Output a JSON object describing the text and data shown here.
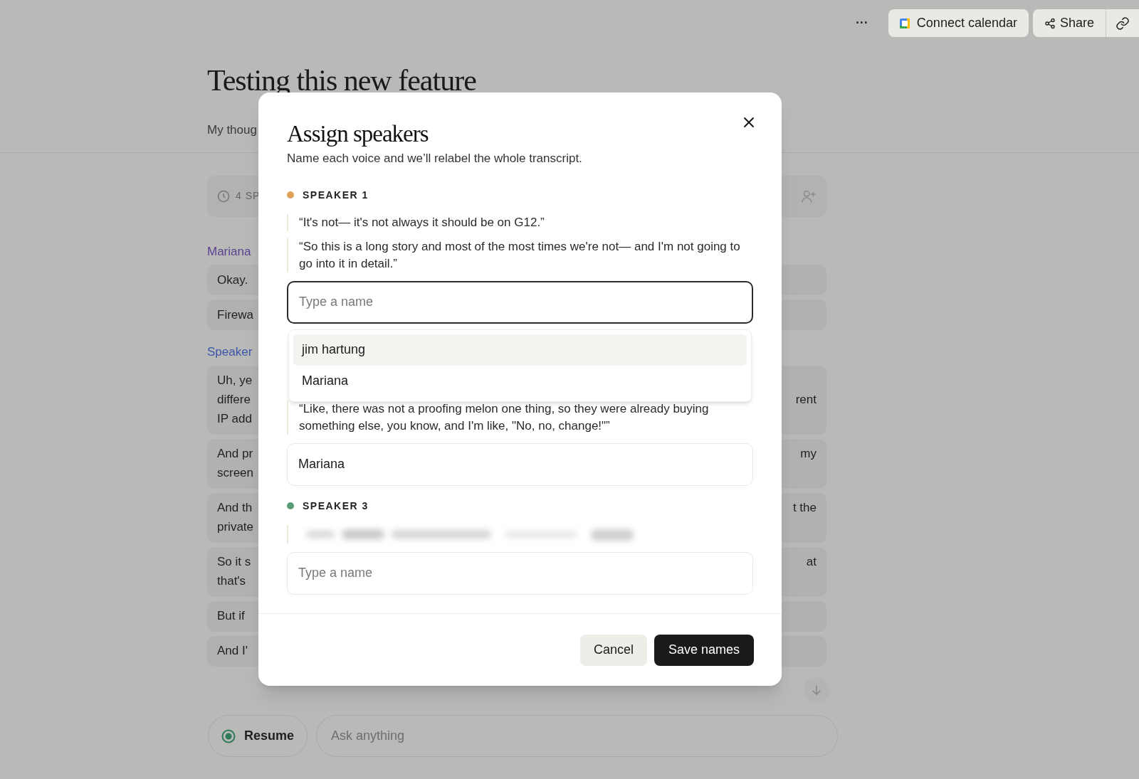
{
  "top_bar": {
    "more": "···",
    "connect_calendar": "Connect calendar",
    "share": "Share"
  },
  "document": {
    "title": "Testing this new feature",
    "subtitle": "My thoug",
    "toolbar_label": "4 SP"
  },
  "transcript": [
    {
      "speaker": "Mariana",
      "color": "#5b3f93",
      "messages": [
        {
          "lines": [
            {
              "left": "Okay."
            }
          ]
        },
        {
          "lines": [
            {
              "left": "Firewa"
            }
          ]
        }
      ]
    },
    {
      "speaker": "Speaker",
      "color": "#3b55aa",
      "messages": [
        {
          "lines": [
            {
              "left": "Uh, ye"
            },
            {
              "left": "differe",
              "right": "rent"
            },
            {
              "left": "IP add"
            }
          ]
        },
        {
          "lines": [
            {
              "left": "And pr",
              "right": "my"
            },
            {
              "left": "screen"
            }
          ]
        },
        {
          "lines": [
            {
              "left": "And th",
              "right": "t the"
            },
            {
              "left": "private"
            }
          ]
        },
        {
          "lines": [
            {
              "left": "So it s",
              "right": "at"
            },
            {
              "left": "that's"
            }
          ]
        },
        {
          "lines": [
            {
              "left": "But if"
            }
          ]
        },
        {
          "lines": [
            {
              "left": "And I'"
            }
          ]
        }
      ]
    }
  ],
  "composer": {
    "resume": "Resume",
    "placeholder": "Ask anything"
  },
  "dialog": {
    "title": "Assign speakers",
    "subtitle": "Name each voice and we’ll relabel the whole transcript.",
    "speakers": [
      {
        "label": "SPEAKER 1",
        "color": "#e0a25a",
        "quotes": [
          {
            "kind": "text",
            "text": "“It's not— it's not always it should be on G12.”"
          },
          {
            "kind": "text",
            "text": "“So this is a long story and most of the most times we're not— and I'm not going to go into it in detail.”"
          }
        ],
        "name_field": {
          "placeholder": "Type a name",
          "focused": true
        },
        "suggestions": [
          {
            "name": "jim hartung",
            "selected": true
          },
          {
            "name": "Mariana",
            "selected": false
          }
        ]
      },
      {
        "quotes": [
          {
            "kind": "text",
            "text": "“Like, there was not a proofing melon one thing, so they were already buying something else, you know, and I'm like, \"No, no, change!\"”"
          }
        ],
        "name_field": {
          "value": "Mariana",
          "focused": false
        }
      },
      {
        "label": "SPEAKER 3",
        "color": "#5a9a78",
        "quotes": [
          {
            "kind": "blurred"
          }
        ],
        "name_field": {
          "placeholder": "Type a name",
          "focused": false
        }
      }
    ],
    "buttons": {
      "cancel": "Cancel",
      "save": "Save names"
    }
  }
}
